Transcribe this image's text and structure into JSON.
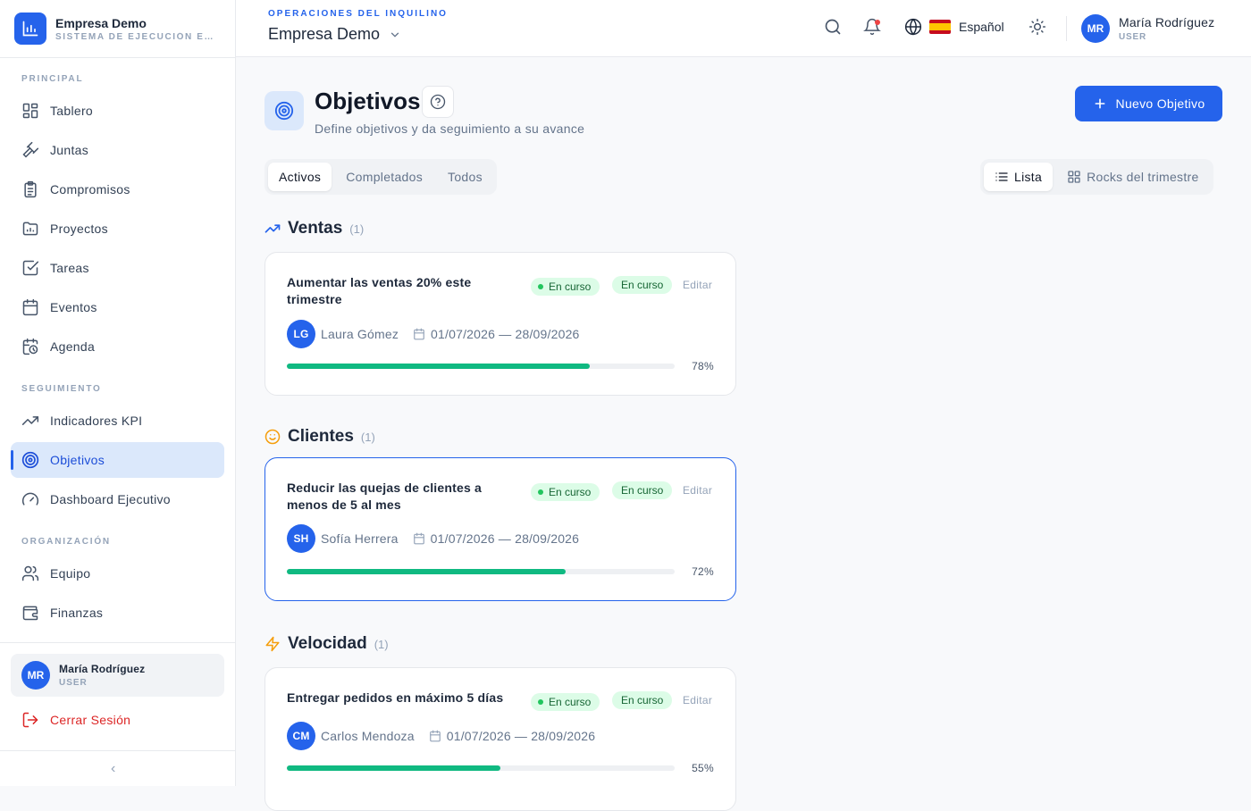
{
  "brand": {
    "name": "Empresa Demo",
    "subtitle": "SISTEMA DE EJECUCIÓN EMPRESARIAL"
  },
  "sidebar": {
    "sections": [
      {
        "label": "PRINCIPAL",
        "items": [
          {
            "label": "Tablero",
            "icon": "dashboard-grid-icon"
          },
          {
            "label": "Juntas",
            "icon": "gavel-icon"
          },
          {
            "label": "Compromisos",
            "icon": "clipboard-icon"
          },
          {
            "label": "Proyectos",
            "icon": "folder-icon"
          },
          {
            "label": "Tareas",
            "icon": "checkbox-icon"
          },
          {
            "label": "Eventos",
            "icon": "calendar-icon"
          },
          {
            "label": "Agenda",
            "icon": "calendar-clock-icon"
          }
        ]
      },
      {
        "label": "SEGUIMIENTO",
        "items": [
          {
            "label": "Indicadores KPI",
            "icon": "trending-up-icon"
          },
          {
            "label": "Objetivos",
            "icon": "target-icon",
            "active": true
          },
          {
            "label": "Dashboard Ejecutivo",
            "icon": "gauge-icon"
          }
        ]
      },
      {
        "label": "ORGANIZACIÓN",
        "items": [
          {
            "label": "Equipo",
            "icon": "users-icon"
          },
          {
            "label": "Finanzas",
            "icon": "wallet-icon"
          }
        ]
      }
    ],
    "user": {
      "initials": "MR",
      "name": "María Rodríguez",
      "role": "USER"
    },
    "logout_label": "Cerrar Sesión",
    "collapse_glyph": "‹"
  },
  "topbar": {
    "tenant_label": "OPERACIONES DEL INQUILINO",
    "tenant_name": "Empresa Demo",
    "language": {
      "flag": "🇪🇸",
      "label": "Español"
    },
    "user": {
      "initials": "MR",
      "name": "María Rodríguez",
      "role": "USER"
    }
  },
  "page": {
    "title": "Objetivos",
    "subtitle": "Define objetivos y da seguimiento a su avance",
    "new_button": "Nuevo Objetivo",
    "filters": [
      "Activos",
      "Completados",
      "Todos"
    ],
    "active_filter": 0,
    "views": [
      "Lista",
      "Rocks del trimestre"
    ],
    "active_view": 0
  },
  "groups": [
    {
      "title": "Ventas",
      "count": "(1)",
      "icon": "trending-up-icon",
      "icon_color": "#2563eb",
      "objective": {
        "title": "Aumentar las ventas 20% este trimestre",
        "status": "En curso",
        "status2": "En curso",
        "edit": "Editar",
        "owner_initials": "LG",
        "owner": "Laura Gómez",
        "dates": "01/07/2026 — 28/09/2026",
        "progress": 78,
        "progress_label": "78%"
      }
    },
    {
      "title": "Clientes",
      "count": "(1)",
      "icon": "smile-icon",
      "icon_color": "#f59e0b",
      "objective": {
        "title": "Reducir las quejas de clientes a menos de 5 al mes",
        "status": "En curso",
        "status2": "En curso",
        "edit": "Editar",
        "owner_initials": "SH",
        "owner": "Sofía Herrera",
        "dates": "01/07/2026 — 28/09/2026",
        "progress": 72,
        "progress_label": "72%"
      }
    },
    {
      "title": "Velocidad",
      "count": "(1)",
      "icon": "zap-icon",
      "icon_color": "#f59e0b",
      "objective": {
        "title": "Entregar pedidos en máximo 5 días",
        "status": "En curso",
        "status2": "En curso",
        "edit": "Editar",
        "owner_initials": "CM",
        "owner": "Carlos Mendoza",
        "dates": "01/07/2026 — 28/09/2026",
        "progress": 55,
        "progress_label": "55%"
      }
    }
  ],
  "colors": {
    "accent": "#2563eb",
    "success": "#10b981",
    "danger": "#dc2626",
    "active_bg": "#dbe8fb"
  }
}
